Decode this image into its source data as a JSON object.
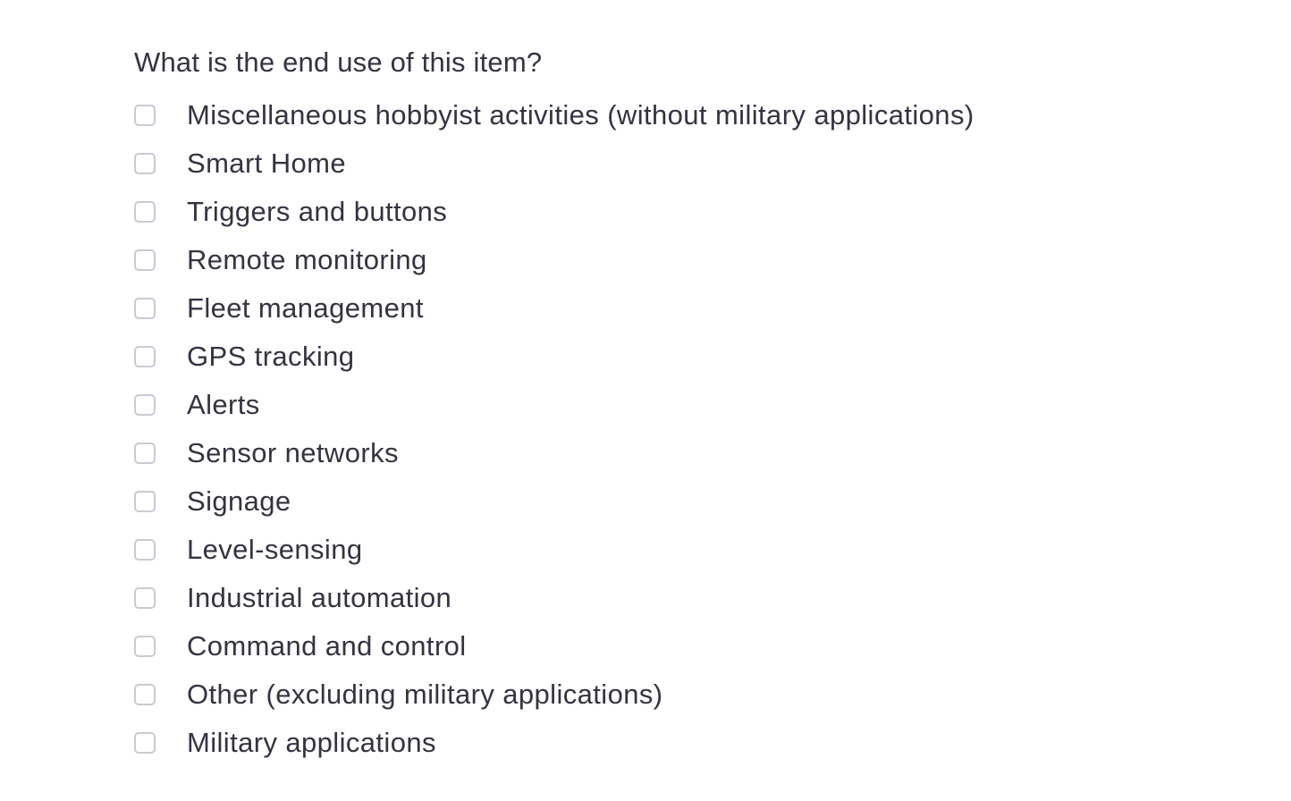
{
  "question": {
    "text": "What is the end use of this item?"
  },
  "options": [
    {
      "label": "Miscellaneous hobbyist activities (without military applications)",
      "checked": false
    },
    {
      "label": "Smart Home",
      "checked": false
    },
    {
      "label": "Triggers and buttons",
      "checked": false
    },
    {
      "label": "Remote monitoring",
      "checked": false
    },
    {
      "label": "Fleet management",
      "checked": false
    },
    {
      "label": "GPS tracking",
      "checked": false
    },
    {
      "label": "Alerts",
      "checked": false
    },
    {
      "label": "Sensor networks",
      "checked": false
    },
    {
      "label": "Signage",
      "checked": false
    },
    {
      "label": "Level-sensing",
      "checked": false
    },
    {
      "label": "Industrial automation",
      "checked": false
    },
    {
      "label": "Command and control",
      "checked": false
    },
    {
      "label": "Other (excluding military applications)",
      "checked": false
    },
    {
      "label": "Military applications",
      "checked": false
    }
  ],
  "colors": {
    "text": "#333440",
    "checkbox_border": "#c8ccd2",
    "background": "#ffffff"
  }
}
